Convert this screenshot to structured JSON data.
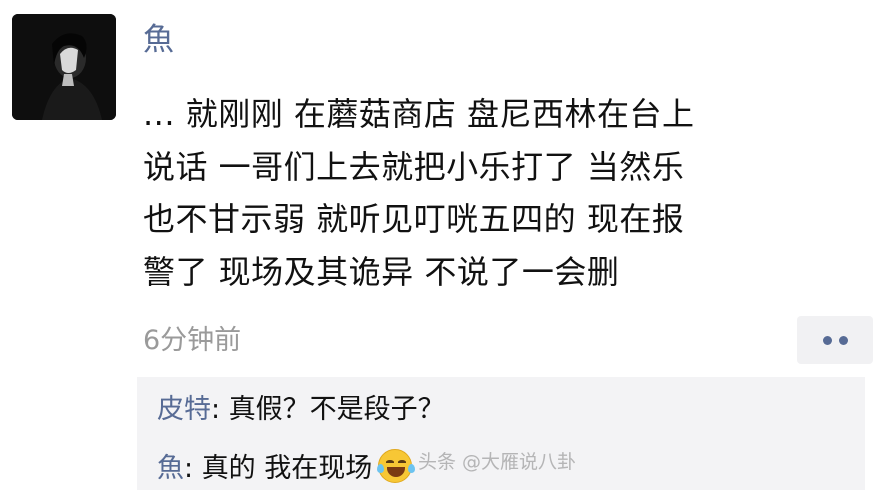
{
  "post": {
    "author": "魚",
    "text": "... 就刚刚 在蘑菇商店 盘尼西林在台上\n说话 一哥们上去就把小乐打了 当然乐\n也不甘示弱 就听见叮咣五四的 现在报\n警了 现场及其诡异 不说了一会删",
    "time": "6分钟前",
    "avatar_icon": "portrait-avatar",
    "more_icon": "ellipsis-icon"
  },
  "comments": [
    {
      "author": "皮特",
      "separator": ": ",
      "text": "真假？不是段子？"
    },
    {
      "author": "魚",
      "separator": ": ",
      "text": "真的 我在现场",
      "emoji": "laughing-tears-emoji"
    }
  ],
  "watermark": "头条 @大雁说八卦",
  "colors": {
    "name_link": "#576b95",
    "text": "#111111",
    "time": "#9a9a9a",
    "comment_bg": "#f3f3f5",
    "background": "#ffffff"
  }
}
